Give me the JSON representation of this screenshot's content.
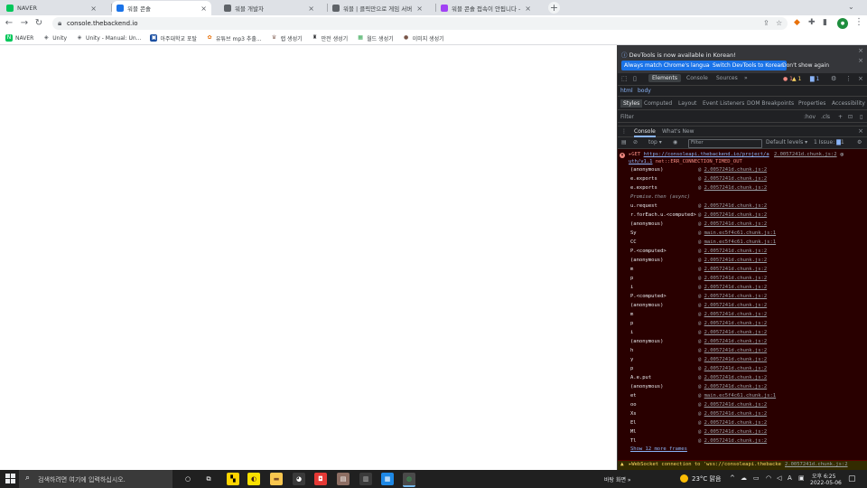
{
  "browser": {
    "tabs": [
      {
        "title": "NAVER",
        "favicon_color": "#03c75a",
        "icon": "naver-favicon"
      },
      {
        "title": "워블 콘솔",
        "favicon_color": "#1a73e8",
        "icon": "workbench-favicon",
        "active": true
      },
      {
        "title": "워블 개발자",
        "favicon_color": "#5f6368",
        "icon": "cloud-favicon"
      },
      {
        "title": "워블 | 클릭만으로 게임 서버 완...",
        "favicon_color": "#5f6368",
        "icon": "cloud-favicon"
      },
      {
        "title": "워블 콘솔 접속이 안됩니다 - 인...",
        "favicon_color": "#a142f4",
        "icon": "community-favicon"
      }
    ],
    "new_tab": "+",
    "url": "console.thebackend.io",
    "bookmarks": [
      {
        "label": "NAVER",
        "icon": "N",
        "color": "#03c75a"
      },
      {
        "label": "Unity",
        "icon": "◈",
        "color": "#5f6368"
      },
      {
        "label": "Unity - Manual: Un...",
        "icon": "◈",
        "color": "#5f6368"
      },
      {
        "label": "아주대학교 포탈",
        "icon": "▣",
        "color": "#1a4ea1"
      },
      {
        "label": "유튜브 mp3 추출...",
        "icon": "✿",
        "color": "#e8710a"
      },
      {
        "label": "랩 생성기",
        "icon": "♛",
        "color": "#8d6e63"
      },
      {
        "label": "만전 생성기",
        "icon": "♜",
        "color": "#202124"
      },
      {
        "label": "월드 생성기",
        "icon": "▦",
        "color": "#34a853"
      },
      {
        "label": "이미지 생성기",
        "icon": "●",
        "color": "#795548"
      }
    ]
  },
  "devtools": {
    "notice": "DevTools is now available in Korean!",
    "notice_buttons": [
      "Always match Chrome's language",
      "Switch DevTools to Korean"
    ],
    "dont_show": "Don't show again",
    "main_tabs": [
      "Elements",
      "Console",
      "Sources"
    ],
    "more_tabs": "»",
    "error_count": "1",
    "warning_count": "1",
    "info_count": "1",
    "crumbs": [
      "html",
      "body"
    ],
    "sub_tabs": [
      "Styles",
      "Computed",
      "Layout",
      "Event Listeners",
      "DOM Breakpoints",
      "Properties",
      "Accessibility"
    ],
    "filter_placeholder": "Filter",
    "filter_hov": ":hov",
    "filter_cls": ".cls",
    "drawer_tabs": [
      "Console",
      "What's New"
    ],
    "console_toolbar": {
      "context": "top",
      "filter_placeholder": "Filter",
      "levels": "Default levels",
      "issues": "1 Issue:",
      "issues_count": "1"
    },
    "error": {
      "prefix": "▸GET ",
      "url": "https://consoleapi.thebackend.io/project/a",
      "url_cont": "uth/v1.1",
      "message": " net::ERR_CONNECTION_TIMED_OUT",
      "source": "2.0057241d.chunk.js:2",
      "frames": [
        {
          "name": "(anonymous)",
          "src": "2.0057241d.chunk.js:2"
        },
        {
          "name": "e.exports",
          "src": "2.0057241d.chunk.js:2"
        },
        {
          "name": "e.exports",
          "src": "2.0057241d.chunk.js:2"
        },
        {
          "name": "Promise.then (async)",
          "src": "",
          "async": true
        },
        {
          "name": "u.request",
          "src": "2.0057241d.chunk.js:2"
        },
        {
          "name": "r.forEach.u.<computed>",
          "src": "2.0057241d.chunk.js:2"
        },
        {
          "name": "(anonymous)",
          "src": "2.0057241d.chunk.js:2"
        },
        {
          "name": "Sy",
          "src": "main.ec5f4c61.chunk.js:1"
        },
        {
          "name": "CC",
          "src": "main.ec5f4c61.chunk.js:1"
        },
        {
          "name": "P.<computed>",
          "src": "2.0057241d.chunk.js:2"
        },
        {
          "name": "(anonymous)",
          "src": "2.0057241d.chunk.js:2"
        },
        {
          "name": "m",
          "src": "2.0057241d.chunk.js:2"
        },
        {
          "name": "p",
          "src": "2.0057241d.chunk.js:2"
        },
        {
          "name": "i",
          "src": "2.0057241d.chunk.js:2"
        },
        {
          "name": "P.<computed>",
          "src": "2.0057241d.chunk.js:2"
        },
        {
          "name": "(anonymous)",
          "src": "2.0057241d.chunk.js:2"
        },
        {
          "name": "m",
          "src": "2.0057241d.chunk.js:2"
        },
        {
          "name": "p",
          "src": "2.0057241d.chunk.js:2"
        },
        {
          "name": "i",
          "src": "2.0057241d.chunk.js:2"
        },
        {
          "name": "(anonymous)",
          "src": "2.0057241d.chunk.js:2"
        },
        {
          "name": "h",
          "src": "2.0057241d.chunk.js:2"
        },
        {
          "name": "y",
          "src": "2.0057241d.chunk.js:2"
        },
        {
          "name": "p",
          "src": "2.0057241d.chunk.js:2"
        },
        {
          "name": "A.e.put",
          "src": "2.0057241d.chunk.js:2"
        },
        {
          "name": "(anonymous)",
          "src": "2.0057241d.chunk.js:2"
        },
        {
          "name": "et",
          "src": "main.ec5f4c61.chunk.js:1"
        },
        {
          "name": "oo",
          "src": "2.0057241d.chunk.js:2"
        },
        {
          "name": "Xs",
          "src": "2.0057241d.chunk.js:2"
        },
        {
          "name": "El",
          "src": "2.0057241d.chunk.js:2"
        },
        {
          "name": "Ml",
          "src": "2.0057241d.chunk.js:2"
        },
        {
          "name": "Tl",
          "src": "2.0057241d.chunk.js:2"
        }
      ],
      "show_more": "Show 12 more frames"
    },
    "warning": {
      "text": "▸WebSocket connection to 'wss://consoleapi.thebacke",
      "source": "2.0057241d.chunk.js:2"
    }
  },
  "taskbar": {
    "search_placeholder": "검색하려면 여기에 입력하십시오.",
    "desktop_label": "바탕 화면",
    "weather": "23°C 맑음",
    "time": "오후 6:25",
    "date": "2022-05-06"
  }
}
